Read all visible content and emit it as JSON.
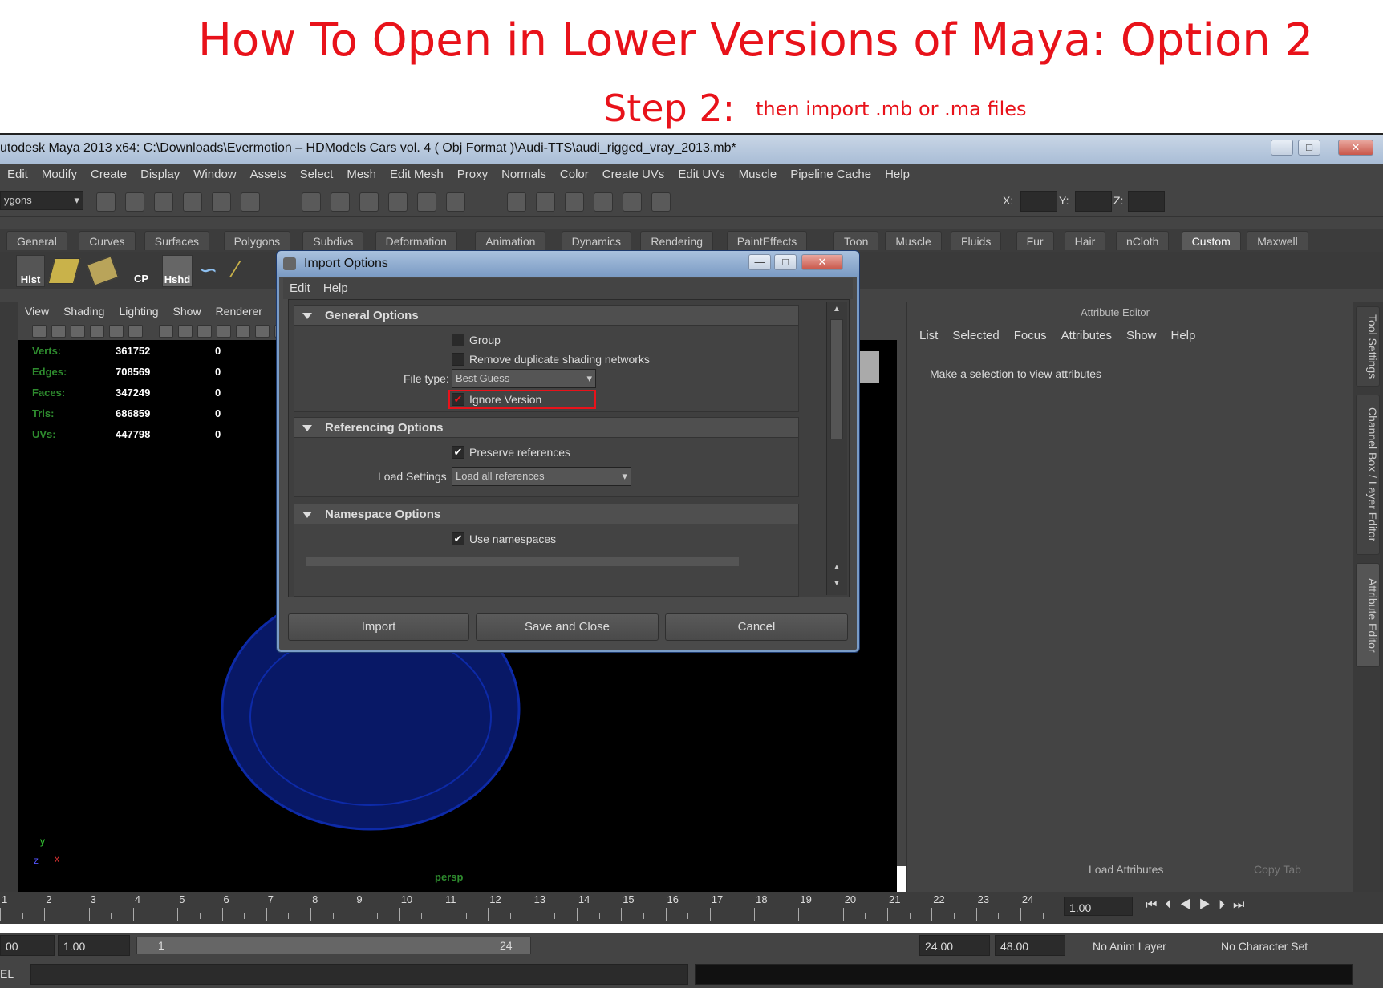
{
  "banner": {
    "title": "How To Open in Lower Versions of Maya: Option 2",
    "step": "Step 2:",
    "step_text": "then import  .mb or  .ma files"
  },
  "window": {
    "title": "utodesk Maya 2013 x64: C:\\Downloads\\Evermotion – HDModels Cars vol. 4 ( Obj Format )\\Audi-TTS\\audi_rigged_vray_2013.mb*",
    "min": "—",
    "max": "□",
    "close": "✕"
  },
  "menubar": [
    "Edit",
    "Modify",
    "Create",
    "Display",
    "Window",
    "Assets",
    "Select",
    "Mesh",
    "Edit Mesh",
    "Proxy",
    "Normals",
    "Color",
    "Create UVs",
    "Edit UVs",
    "Muscle",
    "Pipeline Cache",
    "Help"
  ],
  "toolbar": {
    "mode": "ygons",
    "x_label": "X:",
    "y_label": "Y:",
    "z_label": "Z:"
  },
  "shelf_tabs": [
    "General",
    "Curves",
    "Surfaces",
    "Polygons",
    "Subdivs",
    "Deformation",
    "Animation",
    "Dynamics",
    "Rendering",
    "PaintEffects",
    "Toon",
    "Muscle",
    "Fluids",
    "Fur",
    "Hair",
    "nCloth",
    "Custom",
    "Maxwell"
  ],
  "shelf_active": "Custom",
  "shelf_icons": [
    "Hist",
    "CP",
    "Hshd"
  ],
  "panel_menu": [
    "View",
    "Shading",
    "Lighting",
    "Show",
    "Renderer"
  ],
  "hud": [
    {
      "label": "Verts:",
      "value": "361752",
      "sel": "0"
    },
    {
      "label": "Edges:",
      "value": "708569",
      "sel": "0"
    },
    {
      "label": "Faces:",
      "value": "347249",
      "sel": "0"
    },
    {
      "label": "Tris:",
      "value": "686859",
      "sel": "0"
    },
    {
      "label": "UVs:",
      "value": "447798",
      "sel": "0"
    }
  ],
  "viewport_label": "persp",
  "axis": {
    "y": "y",
    "x": "x",
    "z": "z"
  },
  "attribute_editor": {
    "title": "Attribute Editor",
    "menu": [
      "List",
      "Selected",
      "Focus",
      "Attributes",
      "Show",
      "Help"
    ],
    "message": "Make a selection to view attributes",
    "load_attributes": "Load Attributes",
    "copy_tab": "Copy Tab"
  },
  "side_tabs": [
    "Tool Settings",
    "Channel Box / Layer Editor",
    "Attribute Editor"
  ],
  "timeline": {
    "ticks": [
      "1",
      "2",
      "3",
      "4",
      "5",
      "6",
      "7",
      "8",
      "9",
      "10",
      "11",
      "12",
      "13",
      "14",
      "15",
      "16",
      "17",
      "18",
      "19",
      "20",
      "21",
      "22",
      "23",
      "24"
    ],
    "current": "1.00"
  },
  "range": {
    "start": "00",
    "start2": "1.00",
    "slider_start": "1",
    "slider_end": "24",
    "end": "24.00",
    "end2": "48.00",
    "anim_layer": "No Anim Layer",
    "char_set": "No Character Set"
  },
  "cmd_prefix": "EL",
  "dialog": {
    "title": "Import Options",
    "menu": [
      "Edit",
      "Help"
    ],
    "general_title": "General Options",
    "group": "Group",
    "remove_dup": "Remove duplicate shading networks",
    "file_type_label": "File type:",
    "file_type_value": "Best Guess",
    "ignore_version": "Ignore Version",
    "ref_title": "Referencing Options",
    "preserve_refs": "Preserve references",
    "load_settings_label": "Load Settings",
    "load_settings_value": "Load all references",
    "ns_title": "Namespace Options",
    "use_ns": "Use namespaces",
    "import_btn": "Import",
    "save_close_btn": "Save and Close",
    "cancel_btn": "Cancel",
    "checks": {
      "group": false,
      "remove_dup": false,
      "ignore_version": true,
      "preserve_refs": true,
      "use_ns": true
    },
    "highlight_color": "#e8121a"
  },
  "colors": {
    "accent_red": "#e8121a",
    "hud_green": "#2e8b2e",
    "mesh_blue": "#0a1f8f"
  }
}
